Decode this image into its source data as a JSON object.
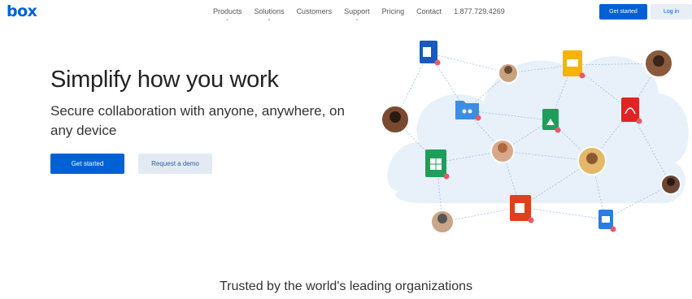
{
  "nav": {
    "logo": "box",
    "links": [
      {
        "label": "Products",
        "dropdown": true
      },
      {
        "label": "Solutions",
        "dropdown": true
      },
      {
        "label": "Customers",
        "dropdown": false
      },
      {
        "label": "Support",
        "dropdown": true
      },
      {
        "label": "Pricing",
        "dropdown": false
      },
      {
        "label": "Contact",
        "dropdown": false
      }
    ],
    "phone": "1.877.729.4269",
    "get_started": "Get started",
    "login": "Log in"
  },
  "hero": {
    "title": "Simplify how you work",
    "subtitle": "Secure collaboration with anyone, anywhere, on any device",
    "primary_cta": "Get started",
    "secondary_cta": "Request a demo"
  },
  "illustration": {
    "icons": [
      "word-doc-icon",
      "slides-doc-icon",
      "folder-shared-icon",
      "image-doc-icon",
      "pdf-doc-icon",
      "sheets-doc-icon",
      "powerpoint-doc-icon",
      "video-doc-icon"
    ],
    "avatars": 7
  },
  "trusted": "Trusted by the world's leading organizations",
  "colors": {
    "brand_blue": "#0061d5",
    "secondary_button_bg": "#e3eaf3",
    "cloud": "#e8f0fa"
  }
}
